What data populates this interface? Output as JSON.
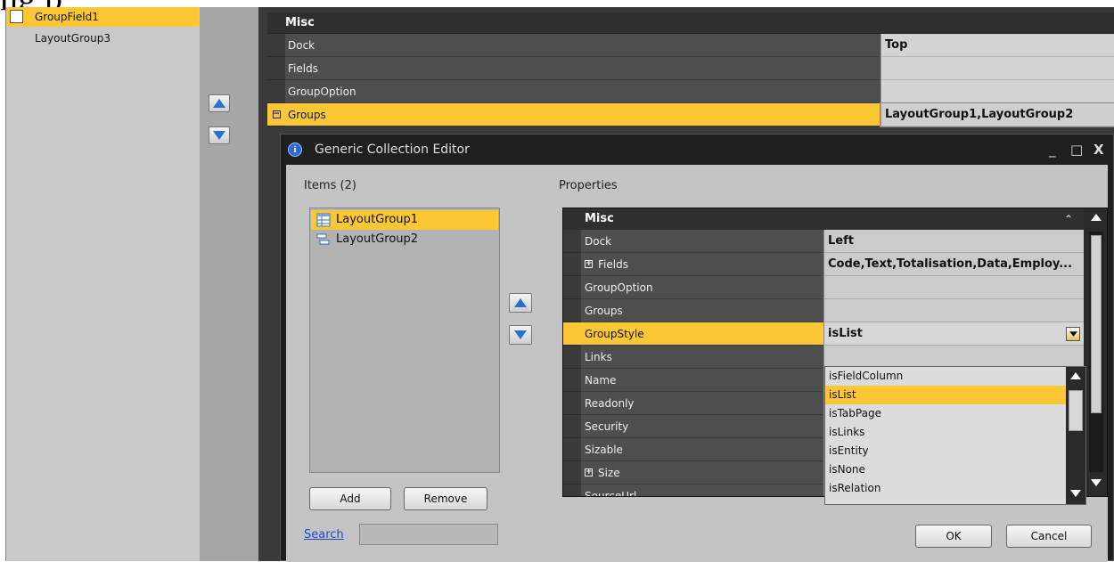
{
  "window_caption_fragment": "ng        p",
  "tree": {
    "items": [
      {
        "label": "GroupField1"
      },
      {
        "label": "LayoutGroup3"
      }
    ]
  },
  "outer_grid": {
    "category": "Misc",
    "rows": [
      {
        "name": "Dock",
        "value": "Top"
      },
      {
        "name": "Fields",
        "value": ""
      },
      {
        "name": "GroupOption",
        "value": ""
      },
      {
        "name": "Groups",
        "value": "LayoutGroup1,LayoutGroup2"
      }
    ]
  },
  "dialog": {
    "title": "Generic Collection Editor",
    "minimize": "_",
    "maximize": "□",
    "close": "X",
    "items_label": "Items (2)",
    "properties_label": "Properties",
    "items": [
      {
        "label": "LayoutGroup1"
      },
      {
        "label": "LayoutGroup2"
      }
    ],
    "add_label": "Add",
    "remove_label": "Remove",
    "search_label": "Search",
    "search_value": "",
    "ok_label": "OK",
    "cancel_label": "Cancel"
  },
  "inner_grid": {
    "category": "Misc",
    "rows": [
      {
        "name": "Dock",
        "value": "Left"
      },
      {
        "name": "Fields",
        "value": "Code,Text,Totalisation,Data,Employ..."
      },
      {
        "name": "GroupOption",
        "value": ""
      },
      {
        "name": "Groups",
        "value": ""
      },
      {
        "name": "GroupStyle",
        "value": "isList"
      },
      {
        "name": "Links",
        "value": ""
      },
      {
        "name": "Name",
        "value": ""
      },
      {
        "name": "Readonly",
        "value": ""
      },
      {
        "name": "Security",
        "value": ""
      },
      {
        "name": "Sizable",
        "value": ""
      },
      {
        "name": "Size",
        "value": ""
      },
      {
        "name": "SourceUrl",
        "value": ""
      }
    ]
  },
  "groupstyle_dropdown": {
    "options": [
      "isFieldColumn",
      "isList",
      "isTabPage",
      "isLinks",
      "isEntity",
      "isNone",
      "isRelation"
    ],
    "selected": "isList"
  },
  "colors": {
    "accent": "#fbc735",
    "dark": "#3a3a3a",
    "panel": "#c4c4c4"
  }
}
